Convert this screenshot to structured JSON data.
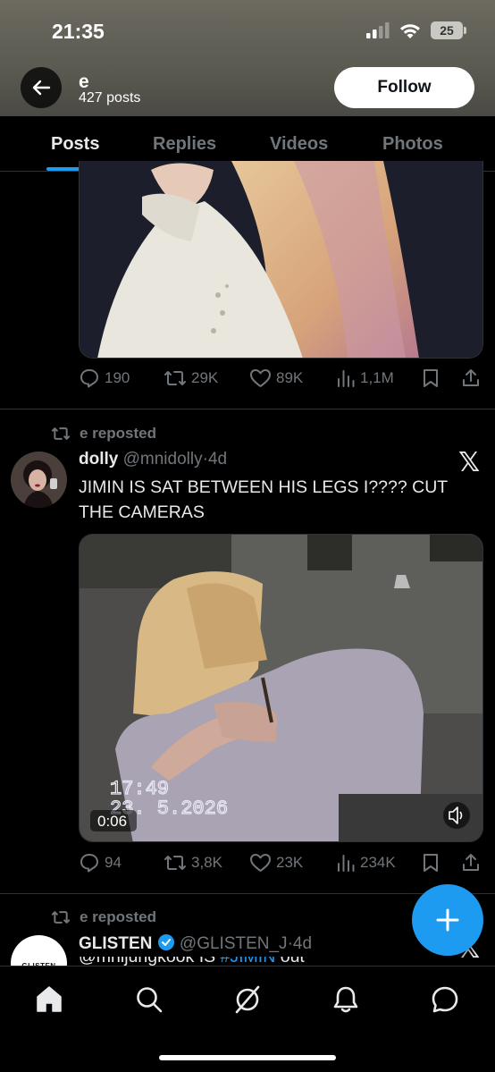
{
  "status_bar": {
    "time": "21:35",
    "battery": "25"
  },
  "profile": {
    "name": "e",
    "posts_count": "427 posts",
    "follow_label": "Follow"
  },
  "tabs": [
    {
      "label": "Posts",
      "active": true
    },
    {
      "label": "Replies",
      "active": false
    },
    {
      "label": "Videos",
      "active": false
    },
    {
      "label": "Photos",
      "active": false
    }
  ],
  "posts": [
    {
      "metrics": {
        "replies": "190",
        "reposts": "29K",
        "likes": "89K",
        "views": "1,1M"
      }
    },
    {
      "repost_by": "e reposted",
      "author_name": "dolly",
      "author_handle": "@mnidolly",
      "time": "4d",
      "text": "JIMIN IS SAT BETWEEN HIS LEGS I???? CUT THE CAMERAS",
      "video": {
        "timestamp_time": "17:49",
        "timestamp_date": "23. 5.2026",
        "duration": "0:06"
      },
      "metrics": {
        "replies": "94",
        "reposts": "3,8K",
        "likes": "23K",
        "views": "234K"
      }
    },
    {
      "repost_by": "e reposted",
      "author_name": "GLISTEN",
      "author_handle": "@GLISTEN_J",
      "time": "4d",
      "text_partial": "@mnijungkook IS ",
      "hashtag_partial": "#JIMIN",
      "text_tail": " out",
      "avatar_text": "GLISTEN"
    }
  ],
  "colors": {
    "accent": "#1d9bf0",
    "muted": "#71767b",
    "background": "#000000"
  },
  "icons": [
    "back-arrow-icon",
    "reply-icon",
    "repost-icon",
    "like-icon",
    "views-icon",
    "bookmark-icon",
    "share-icon",
    "x-logo-icon",
    "verified-icon",
    "volume-icon",
    "plus-icon",
    "home-icon",
    "search-icon",
    "grok-icon",
    "notifications-icon",
    "messages-icon"
  ]
}
